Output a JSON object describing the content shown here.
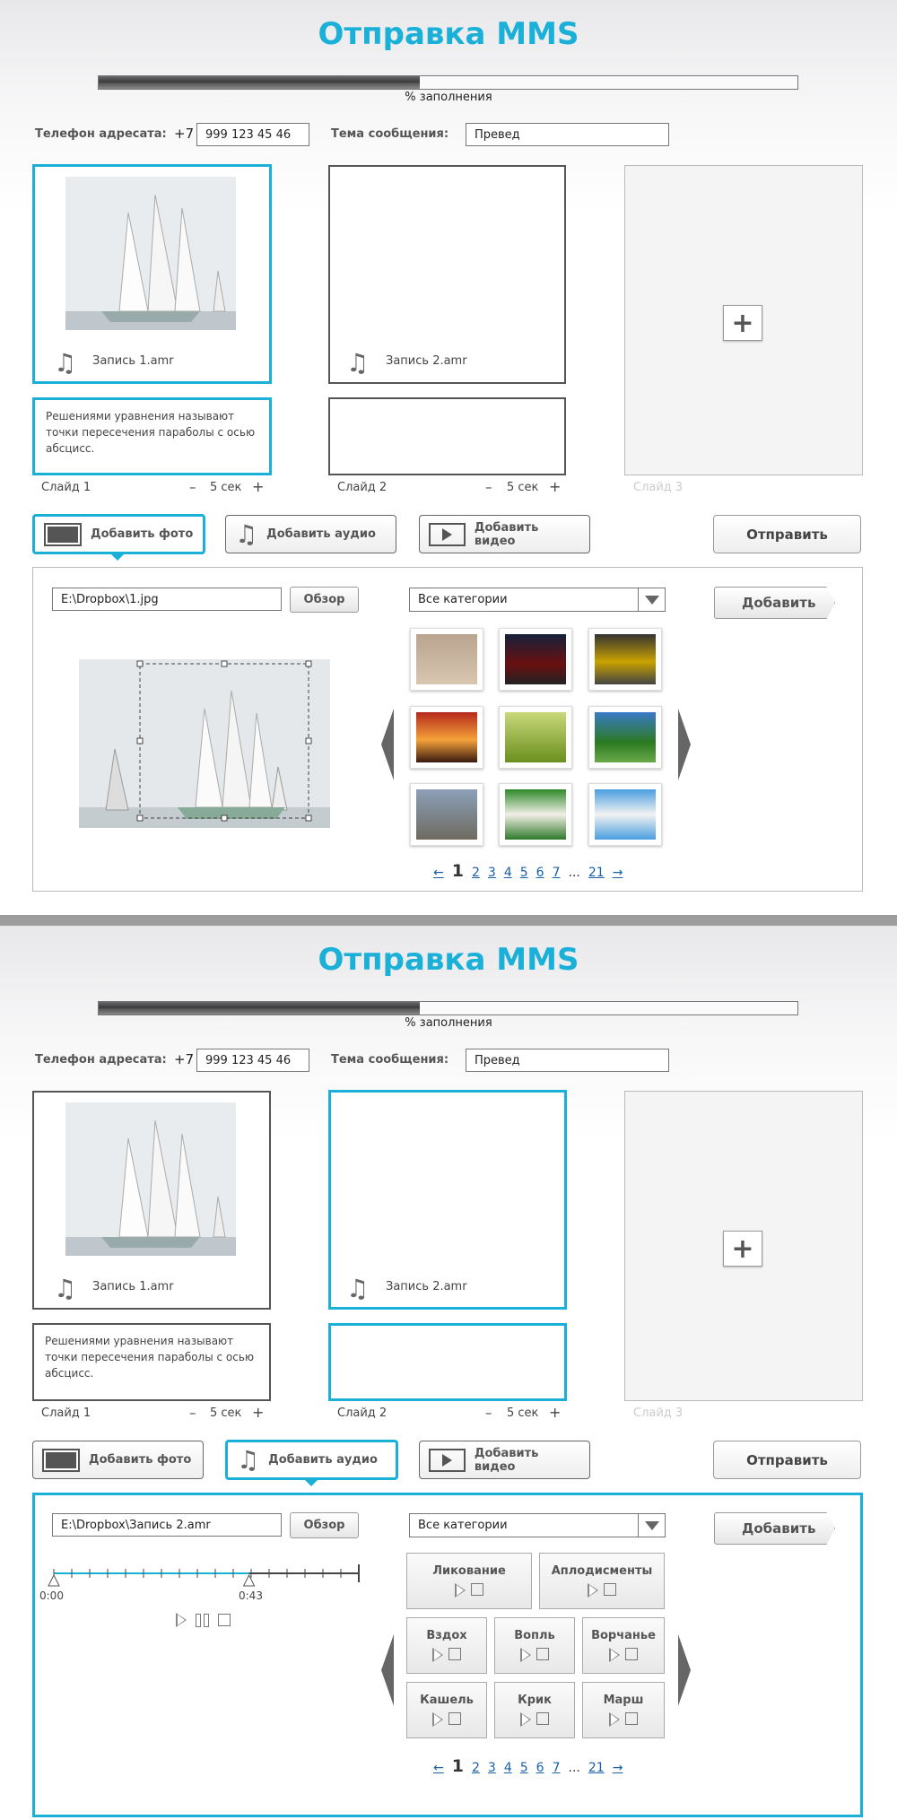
{
  "title": "Отправка MMS",
  "progress": {
    "label": "% заполнения",
    "fraction": 0.46
  },
  "recipient": {
    "label": "Телефон адресата:",
    "prefix": "+7",
    "value": "999 123 45 46"
  },
  "subject": {
    "label": "Тема сообщения:",
    "value": "Превед"
  },
  "slides": [
    {
      "audio": "Запись 1.amr",
      "text": "Решениями  уравнения называют точки пересечения параболы с осью абсцисс.",
      "caption": "Слайд 1",
      "duration": "5 сек"
    },
    {
      "audio": "Запись 2.amr",
      "text": "",
      "caption": "Слайд 2",
      "duration": "5 сек"
    },
    {
      "caption": "Слайд 3"
    }
  ],
  "buttons": {
    "add_photo": "Добавить фото",
    "add_audio": "Добавить аудио",
    "add_video": "Добавить видео",
    "send": "Отправить",
    "browse": "Обзор",
    "add": "Добавить",
    "minus": "–",
    "plus": "+"
  },
  "photo_panel": {
    "path": "E:\\Dropbox\\1.jpg",
    "category": "Все категории"
  },
  "audio_panel": {
    "path": "E:\\Dropbox\\Запись 2.amr",
    "category": "Все категории",
    "time_start": "0:00",
    "time_current": "0:43",
    "position_fraction": 0.64
  },
  "sounds": [
    "Ликование",
    "Аплодисменты",
    "Вздох",
    "Вопль",
    "Ворчанье",
    "Кашель",
    "Крик",
    "Марш"
  ],
  "pager": {
    "prev": "←",
    "current": "1",
    "pages": [
      "2",
      "3",
      "4",
      "5",
      "6",
      "7"
    ],
    "dots": "...",
    "last": "21",
    "next": "→"
  },
  "colors": {
    "accent": "#1ab0d8",
    "dark": "#555555"
  }
}
